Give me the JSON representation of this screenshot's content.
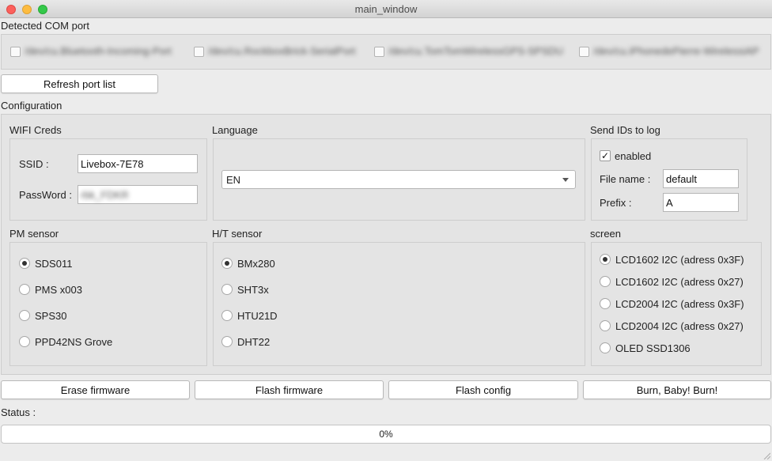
{
  "window": {
    "title": "main_window"
  },
  "com_ports": {
    "label": "Detected COM port",
    "ports": [
      "/dev/cu.Bluetooth-Incoming-Port",
      "/dev/cu.RockboxBrick-SerialPort",
      "/dev/cu.TomTomWirelessGPS-SPSDU",
      "/dev/cu.iPhonedePierre-WirelessiAP"
    ],
    "refresh_label": "Refresh port list"
  },
  "configuration": {
    "label": "Configuration",
    "wifi": {
      "label": "WIFI Creds",
      "ssid_label": "SSID :",
      "ssid_value": "Livebox-7E78",
      "password_label": "PassWord :",
      "password_value": "rbk_FDKR"
    },
    "language": {
      "label": "Language",
      "selected": "EN"
    },
    "send_ids": {
      "label": "Send IDs to log",
      "enabled_label": "enabled",
      "enabled": true,
      "filename_label": "File name :",
      "filename_value": "default",
      "prefix_label": "Prefix :",
      "prefix_value": "A"
    },
    "pm_sensor": {
      "label": "PM sensor",
      "options": [
        "SDS011",
        "PMS x003",
        "SPS30",
        "PPD42NS Grove"
      ],
      "selected": "SDS011"
    },
    "ht_sensor": {
      "label": "H/T sensor",
      "options": [
        "BMx280",
        "SHT3x",
        "HTU21D",
        "DHT22"
      ],
      "selected": "BMx280"
    },
    "screen": {
      "label": "screen",
      "options": [
        "LCD1602 I2C (adress 0x3F)",
        "LCD1602 I2C (adress 0x27)",
        "LCD2004 I2C (adress 0x3F)",
        "LCD2004 I2C (adress 0x27)",
        "OLED SSD1306"
      ],
      "selected": "LCD1602 I2C (adress 0x3F)"
    }
  },
  "actions": {
    "erase": "Erase firmware",
    "flash": "Flash firmware",
    "flash_config": "Flash config",
    "burn": "Burn, Baby! Burn!"
  },
  "status": {
    "label": "Status :",
    "progress_text": "0%",
    "progress_value": 0
  }
}
